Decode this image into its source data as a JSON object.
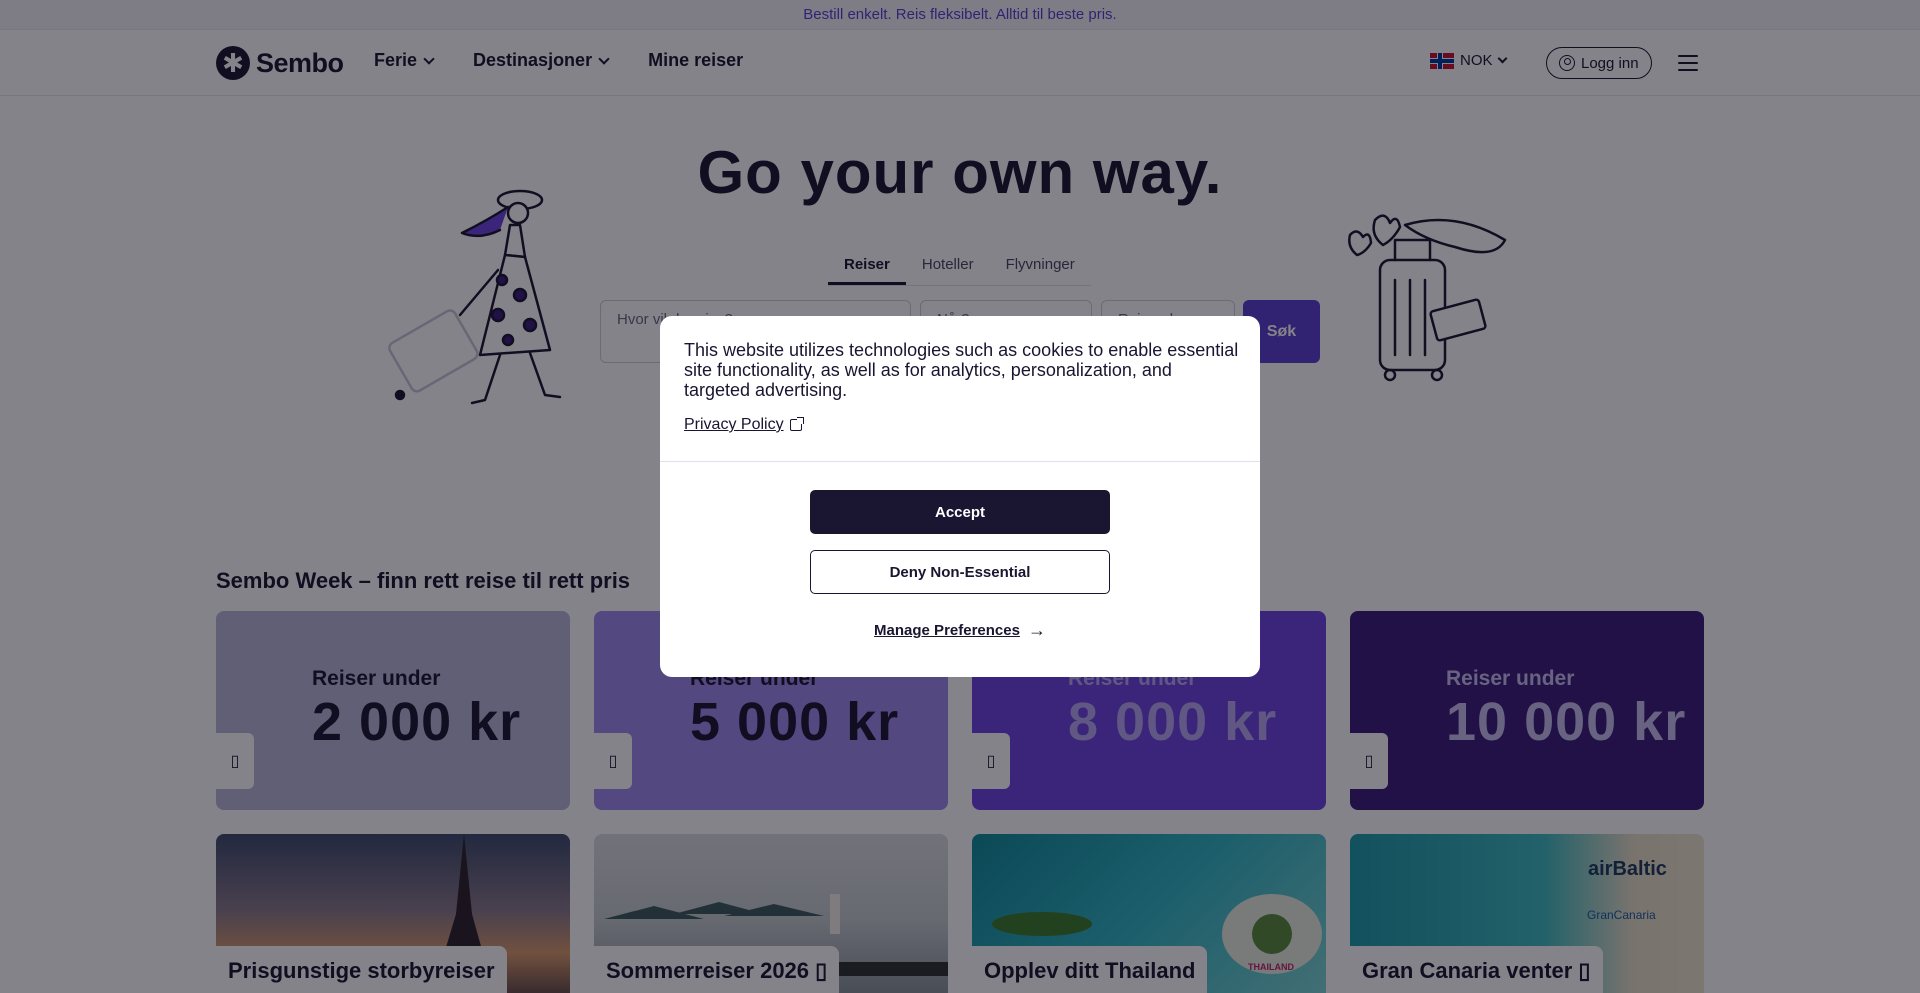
{
  "promo": {
    "text": "Bestill enkelt. Reis fleksibelt. Alltid til beste pris."
  },
  "header": {
    "logo_text": "Sembo",
    "nav": [
      {
        "label": "Ferie"
      },
      {
        "label": "Destinasjoner"
      },
      {
        "label": "Mine reiser"
      }
    ],
    "currency": "NOK",
    "login": "Logg inn"
  },
  "hero": {
    "title": "Go your own way.",
    "tabs": [
      {
        "label": "Reiser"
      },
      {
        "label": "Hoteller"
      },
      {
        "label": "Flyvninger"
      }
    ],
    "search": {
      "where_placeholder": "Hvor vil du reise?",
      "from_placeholder": "Når?",
      "guests_placeholder": "Reisende",
      "button": "Søk"
    }
  },
  "section": {
    "title": "Sembo Week – finn rett reise til rett pris",
    "deals": [
      {
        "sub": "Reiser under",
        "amount": "2 000 kr",
        "bg": "#b9b6d6",
        "fg": "#1a1530",
        "icon": "▯"
      },
      {
        "sub": "Reiser under",
        "amount": "5 000 kr",
        "bg": "#9d88ea",
        "fg": "#1a1530",
        "icon": "▯"
      },
      {
        "sub": "Reiser under",
        "amount": "8 000 kr",
        "bg": "#6a42e0",
        "fg": "#b6a6f2",
        "icon": "▯"
      },
      {
        "sub": "Reiser under",
        "amount": "10 000 kr",
        "bg": "#3a1a7a",
        "fg": "#c9bff0",
        "icon": "▯"
      }
    ],
    "photos": [
      {
        "label": "Prisgunstige storbyreiser"
      },
      {
        "label": "Sommerreiser 2026 ▯"
      },
      {
        "label": "Opplev ditt Thailand"
      },
      {
        "label": "Gran Canaria venter ▯"
      }
    ],
    "photo_brand": {
      "line1": "airBaltic",
      "line2": "GranCanaria",
      "thailand": "THAILAND"
    }
  },
  "cookie": {
    "text": "This website utilizes technologies such as cookies to enable essential site functionality, as well as for analytics, personalization, and targeted advertising.",
    "privacy": "Privacy Policy",
    "accept": "Accept",
    "deny": "Deny Non-Essential",
    "manage": "Manage Preferences",
    "manage_arrow": "→"
  },
  "colors": {
    "brand": "#5b3fd0",
    "dark": "#1a1530"
  }
}
